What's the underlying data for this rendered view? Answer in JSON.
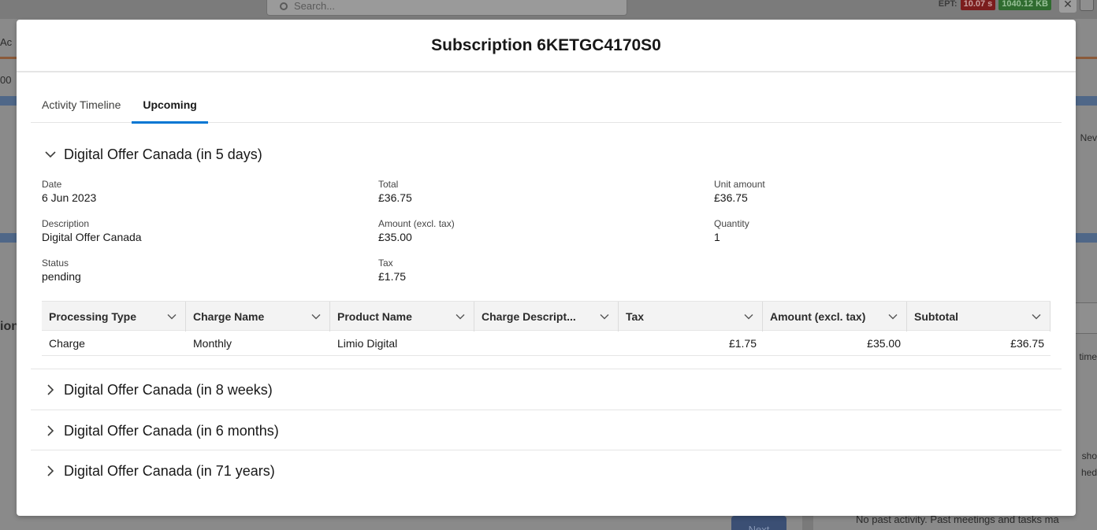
{
  "background": {
    "search_placeholder": "Search...",
    "ept_label": "EPT:",
    "ept_time": "10.07 s",
    "ept_size": "1040.12 KB",
    "left_fragments": [
      "Ac",
      "00",
      "ion"
    ],
    "right_fragments": [
      "Nev",
      "time",
      "sho",
      "hed"
    ],
    "next_button": "Next",
    "activity_text": "No past activity. Past meetings and tasks ma"
  },
  "modal": {
    "title": "Subscription 6KETGC4170S0"
  },
  "tabs": [
    {
      "label": "Activity Timeline",
      "active": false
    },
    {
      "label": "Upcoming",
      "active": true
    }
  ],
  "sections": [
    {
      "title": "Digital Offer Canada (in 5 days)",
      "expanded": true
    },
    {
      "title": "Digital Offer Canada (in 8 weeks)",
      "expanded": false
    },
    {
      "title": "Digital Offer Canada (in 6 months)",
      "expanded": false
    },
    {
      "title": "Digital Offer Canada (in 71 years)",
      "expanded": false
    }
  ],
  "details": {
    "date_label": "Date",
    "date_value": "6 Jun 2023",
    "description_label": "Description",
    "description_value": "Digital Offer Canada",
    "status_label": "Status",
    "status_value": "pending",
    "total_label": "Total",
    "total_value": "£36.75",
    "amount_label": "Amount (excl. tax)",
    "amount_value": "£35.00",
    "tax_label": "Tax",
    "tax_value": "£1.75",
    "unit_amount_label": "Unit amount",
    "unit_amount_value": "£36.75",
    "quantity_label": "Quantity",
    "quantity_value": "1"
  },
  "table": {
    "columns": [
      "Processing Type",
      "Charge Name",
      "Product Name",
      "Charge Descript...",
      "Tax",
      "Amount (excl. tax)",
      "Subtotal"
    ],
    "rows": [
      [
        "Charge",
        "Monthly",
        "Limio Digital",
        "",
        "£1.75",
        "£35.00",
        "£36.75"
      ]
    ]
  }
}
